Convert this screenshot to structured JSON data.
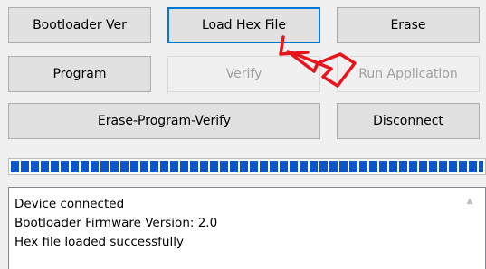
{
  "buttons": {
    "bootloader_ver": "Bootloader Ver",
    "load_hex_file": "Load Hex File",
    "erase": "Erase",
    "program": "Program",
    "verify": "Verify",
    "run_application": "Run Application",
    "erase_program_verify": "Erase-Program-Verify",
    "disconnect": "Disconnect"
  },
  "progress": {
    "percent": 100
  },
  "status_log": {
    "lines": [
      "Device connected",
      "Bootloader Firmware Version: 2.0",
      "Hex file loaded successfully"
    ]
  },
  "annotation": {
    "arrow_color": "#e8141c",
    "icon": "curved-arrow-icon"
  },
  "colors": {
    "progress_fill": "#0c55c9",
    "focus_border": "#0078d7"
  }
}
